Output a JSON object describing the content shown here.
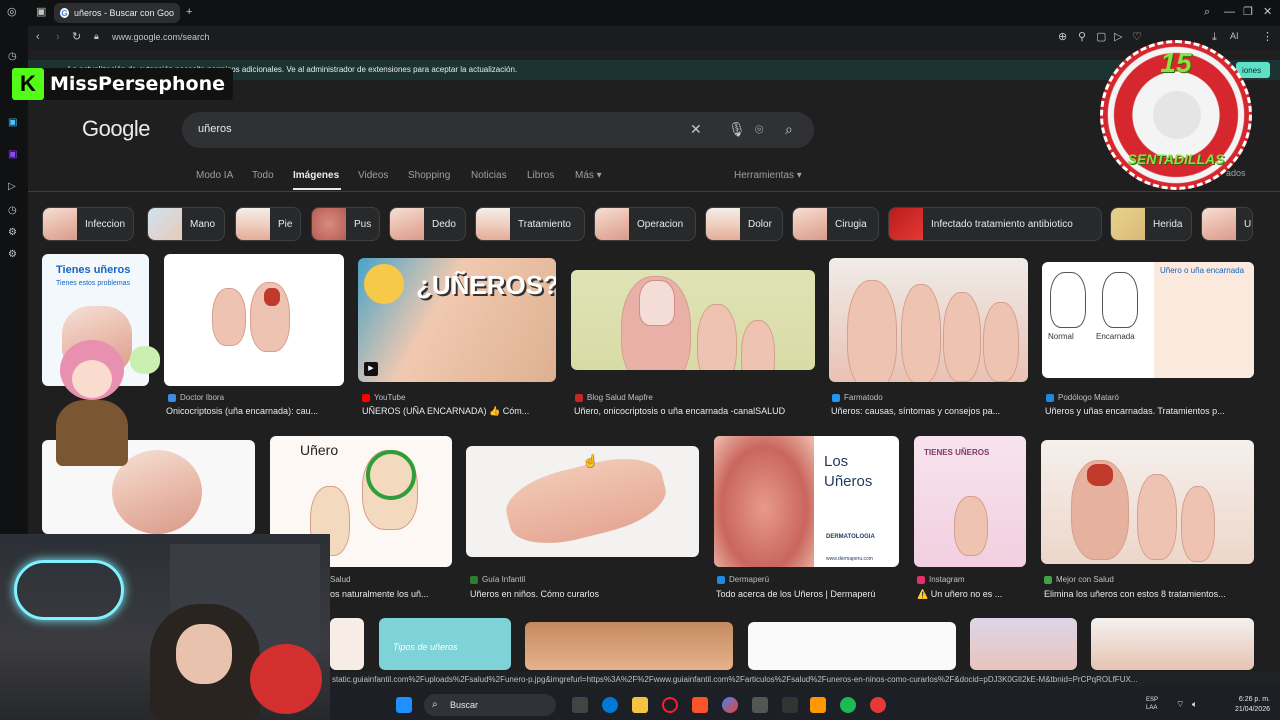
{
  "browser": {
    "tab_title": "uñeros - Buscar con Goo",
    "url": "www.google.com/search",
    "notice": "La actualización de extensión necesita permisos adicionales. Ve al administrador de extensiones para aceptar la actualización.",
    "notice_button": "iones"
  },
  "google": {
    "logo": "Google",
    "query": "uñeros",
    "nav": [
      "Modo IA",
      "Todo",
      "Imágenes",
      "Videos",
      "Shopping",
      "Noticias",
      "Libros",
      "Más ▾"
    ],
    "tools": "Herramientas ▾",
    "safe": "ados"
  },
  "chips": [
    "Infeccion",
    "Mano",
    "Pie",
    "Pus",
    "Dedo",
    "Tratamiento",
    "Operacion",
    "Dolor",
    "Cirugia",
    "Infectado tratamiento antibiotico",
    "Herida",
    "U"
  ],
  "results_row1": [
    {
      "source": "Doctor Ibora",
      "caption": "Onicocriptosis (uña encarnada): cau..."
    },
    {
      "source": "YouTube",
      "caption": "UÑEROS (UÑA ENCARNADA) 👍 Cóm..."
    },
    {
      "source": "Blog Salud Mapfre",
      "caption": "Uñero, onicocriptosis o uña encarnada -canalSALUD"
    },
    {
      "source": "Farmatodo",
      "caption": "Uñeros: causas, síntomas y consejos pa..."
    },
    {
      "source": "Podólogo Mataró",
      "caption": "Uñeros y uñas encarnadas. Tratamientos p..."
    }
  ],
  "results_row2": [
    {
      "source": "Salud",
      "caption": "os naturalmente los uñ..."
    },
    {
      "source": "Guía Infantil",
      "caption": "Uñeros en niños. Cómo curarlos"
    },
    {
      "source": "Dermaperú",
      "caption": "Todo acerca de los Uñeros | Dermaperú"
    },
    {
      "source": "Instagram",
      "caption": "⚠️ Un uñero no es ..."
    },
    {
      "source": "Mejor con Salud",
      "caption": "Elimina los uñeros con estos 8 tratamientos..."
    }
  ],
  "image_text": {
    "thumb1_title": "Tienes uñeros",
    "thumb1_sub": "Tienes estos problemas",
    "thumb3_title": "¿UÑEROS?",
    "thumb6_normal": "Normal",
    "thumb6_encarnada": "Encarnada",
    "thumb6_header": "Uñero o uña encarnada",
    "thumb8_label": "Uñero",
    "thumb10_title": "Los Uñeros",
    "thumb10_brand": "DERMATOLOGIA",
    "thumb10_site": "www.dermaperu.com",
    "thumb11_title": "TIENES UÑEROS",
    "thumb12_title": "Tipos de uñeros"
  },
  "overlay": {
    "brand_k": "K",
    "brand_name": "MissPersephone",
    "badge_number": "15",
    "badge_text": "SENTADILLAS"
  },
  "status_url": "static.guiainfantil.com%2Fuploads%2Fsalud%2Funero-p.jpg&imgrefurl=https%3A%2F%2Fwww.guiainfantil.com%2Farticulos%2Fsalud%2Funeros-en-ninos-como-curarlos%2F&docid=pDJ3K0GlI2kE-M&tbnid=PrCPqROLfFUX...",
  "taskbar": {
    "search": "Buscar",
    "lang": "ESP\nLAA",
    "time": "6:26 p. m.",
    "date": "21/04/2026"
  }
}
